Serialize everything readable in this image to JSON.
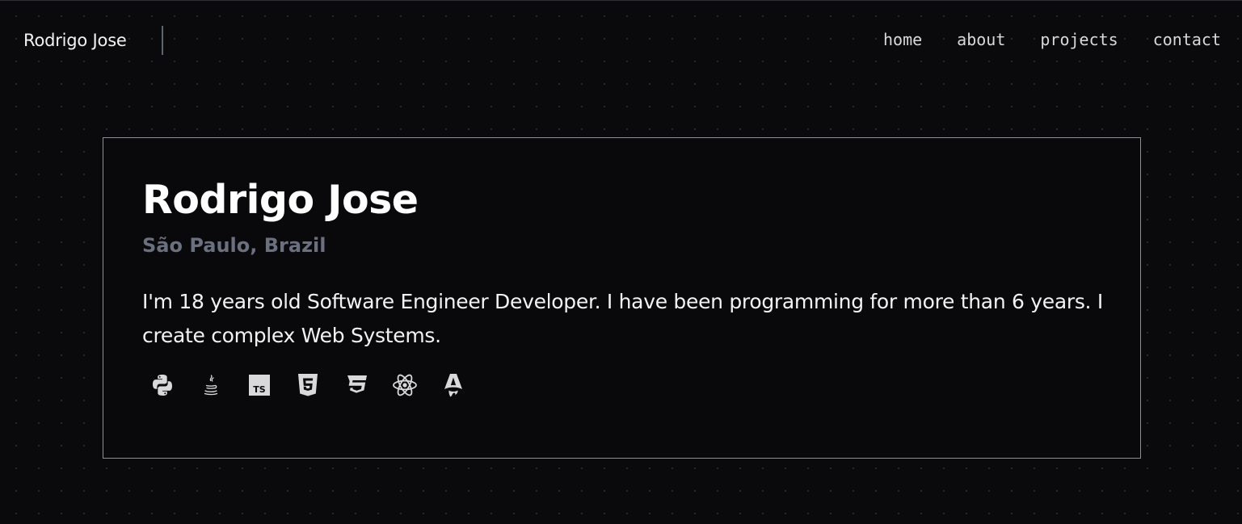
{
  "header": {
    "brand": "Rodrigo Jose",
    "nav": [
      "home",
      "about",
      "projects",
      "contact"
    ]
  },
  "hero": {
    "name": "Rodrigo Jose",
    "location": "São Paulo, Brazil",
    "bio": "I'm 18 years old Software Engineer Developer. I have been programming for more than 6 years. I create complex Web Systems.",
    "tech_icons": [
      "python-icon",
      "java-icon",
      "typescript-icon",
      "html5-icon",
      "css3-icon",
      "react-icon",
      "astro-icon"
    ],
    "ts_badge": "TS"
  },
  "colors": {
    "background": "#0a0a0c",
    "card_border": "#8e8f94",
    "location_text": "#6b7080",
    "nav_text": "#d9d9dc"
  }
}
